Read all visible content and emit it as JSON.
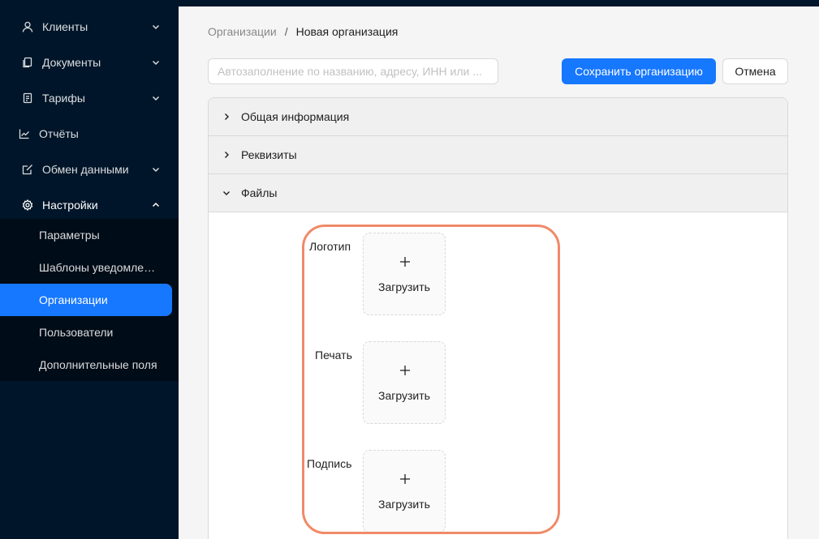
{
  "sidebar": {
    "items": [
      {
        "label": "Клиенты",
        "icon": "user-icon",
        "chevron": "down"
      },
      {
        "label": "Документы",
        "icon": "document-icon",
        "chevron": "down"
      },
      {
        "label": "Тарифы",
        "icon": "tariff-icon",
        "chevron": "down"
      },
      {
        "label": "Отчёты",
        "icon": "chart-icon",
        "chevron": null
      },
      {
        "label": "Обмен данными",
        "icon": "edit-icon",
        "chevron": "down"
      },
      {
        "label": "Настройки",
        "icon": "gear-icon",
        "chevron": "up"
      }
    ],
    "submenu": [
      {
        "label": "Параметры"
      },
      {
        "label": "Шаблоны уведомлений"
      },
      {
        "label": "Организации",
        "active": true
      },
      {
        "label": "Пользователи"
      },
      {
        "label": "Дополнительные поля"
      }
    ]
  },
  "breadcrumb": {
    "parent": "Организации",
    "separator": "/",
    "current": "Новая организация"
  },
  "search": {
    "value": "",
    "placeholder": "Автозаполнение по названию, адресу, ИНН или ..."
  },
  "toolbar": {
    "save_label": "Сохранить организацию",
    "cancel_label": "Отмена"
  },
  "panels": [
    {
      "label": "Общая информация",
      "expanded": false
    },
    {
      "label": "Реквизиты",
      "expanded": false
    },
    {
      "label": "Файлы",
      "expanded": true
    }
  ],
  "files": [
    {
      "label": "Логотип",
      "upload_label": "Загрузить"
    },
    {
      "label": "Печать",
      "upload_label": "Загрузить"
    },
    {
      "label": "Подпись",
      "upload_label": "Загрузить"
    }
  ],
  "colors": {
    "sidebar_bg": "#001529",
    "submenu_bg": "#000c17",
    "accent": "#1677ff",
    "highlight": "#f08a68"
  }
}
